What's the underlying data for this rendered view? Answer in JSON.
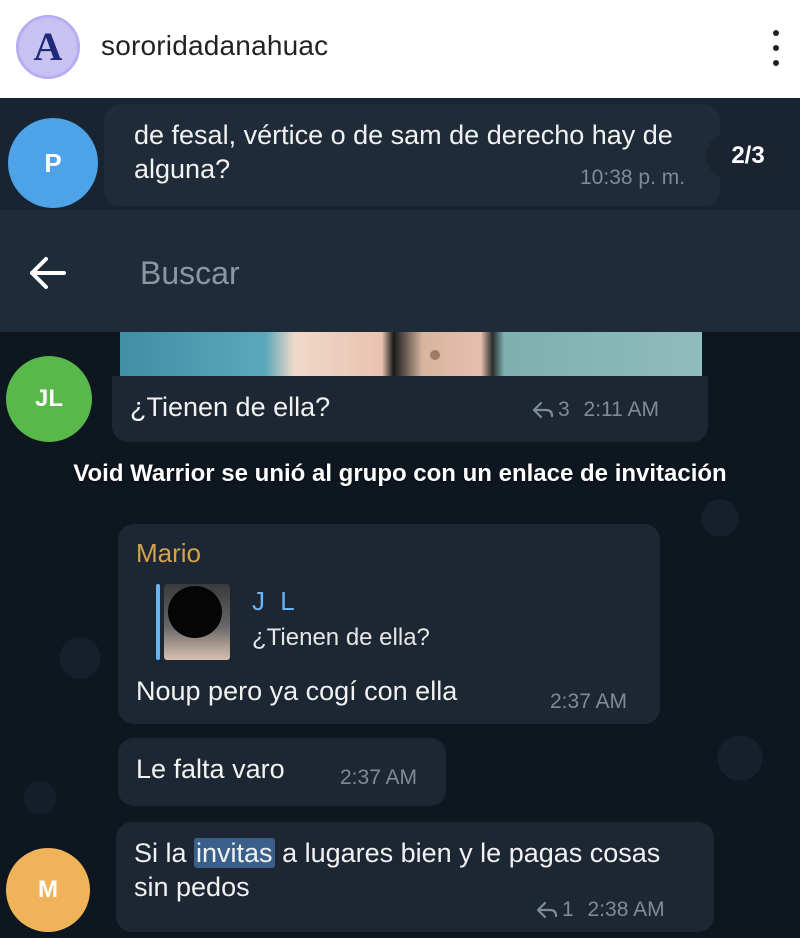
{
  "post_header": {
    "account_name": "sororidadanahuac",
    "logo_letter": "A",
    "more_icon": "more-vertical-icon"
  },
  "search_result": {
    "avatar_letter": "P",
    "avatar_color": "#4ea3e8",
    "text": "de fesal, vértice o de sam de derecho hay de alguna?",
    "time": "10:38 p. m.",
    "counter": "2/3"
  },
  "search_bar": {
    "placeholder": "Buscar",
    "back_icon": "arrow-left-icon"
  },
  "messages": [
    {
      "avatar_letter": "JL",
      "avatar_color": "#58b84a",
      "text": "¿Tienen de ella?",
      "replies": "3",
      "time": "2:11 AM"
    }
  ],
  "system_note": "Void Warrior se unió al grupo con un enlace de invitación",
  "mario_message": {
    "sender": "Mario",
    "sender_color": "#d4a24a",
    "quote_author": "J L",
    "quote_text": "¿Tienen de ella?",
    "text": "Noup pero ya cogí con ella",
    "time": "2:37 AM"
  },
  "followups": [
    {
      "text": "Le falta varo",
      "time": "2:37 AM"
    }
  ],
  "last_message": {
    "avatar_letter": "M",
    "avatar_color": "#f0b35a",
    "text_before": "Si la ",
    "text_highlight": "invitas",
    "text_after": " a lugares bien y le pagas cosas sin pedos",
    "replies": "1",
    "time": "2:38 AM"
  },
  "colors": {
    "chat_background": "#0e1620",
    "bubble": "#1c2733",
    "accent": "#6ab3f3"
  }
}
